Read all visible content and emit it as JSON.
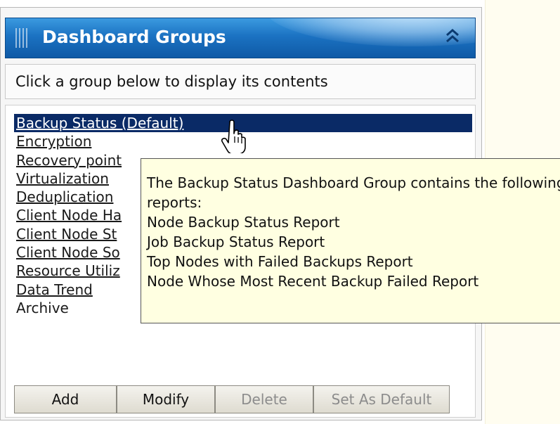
{
  "header": {
    "title": "Dashboard Groups",
    "collapse_glyph": "˄˄"
  },
  "instruction": "Click a group below to display its contents",
  "groups": [
    "Backup Status (Default)",
    "Encryption",
    "Recovery point",
    "Virtualization",
    "Deduplication",
    "Client Node Ha",
    "Client Node St",
    "Client Node So",
    "Resource Utiliz",
    "Data Trend",
    "Archive"
  ],
  "selected_group": "Backup Status (Default)",
  "buttons": {
    "add": "Add",
    "modify": "Modify",
    "delete": "Delete",
    "set_default": "Set As Default"
  },
  "tooltip": {
    "line1": "The Backup Status Dashboard Group contains the following",
    "line2": "reports:",
    "reports": [
      "Node Backup Status Report",
      "Job Backup Status Report",
      "Top Nodes with Failed Backups Report",
      "Node Whose Most Recent Backup Failed Report"
    ]
  },
  "colors": {
    "header_blue": "#1b72c2",
    "selected_row": "#0a2a66",
    "tooltip_bg": "#ffffe1"
  }
}
